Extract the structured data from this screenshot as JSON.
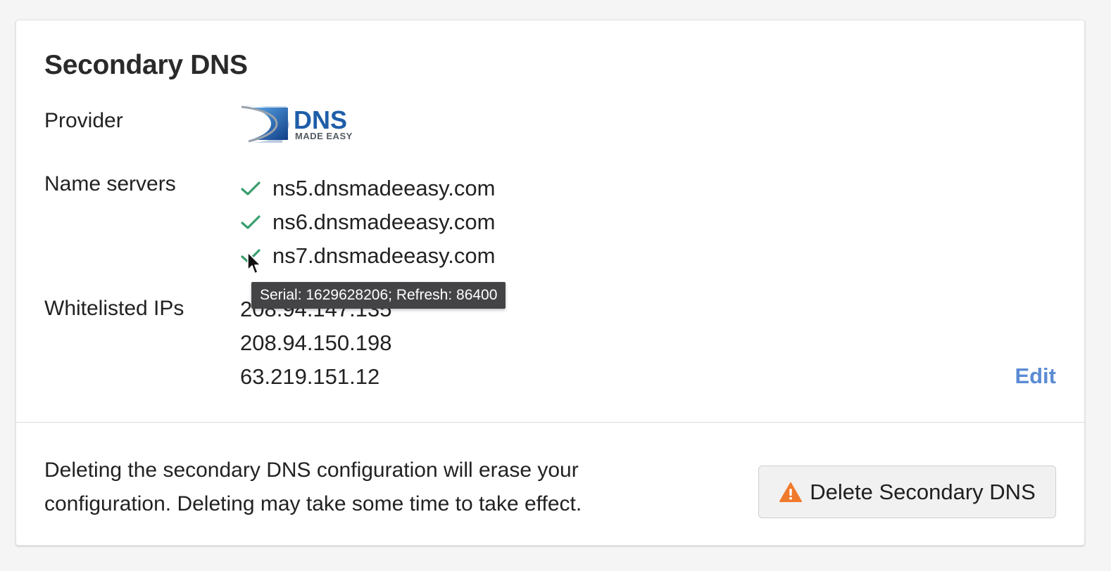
{
  "panel": {
    "title": "Secondary DNS"
  },
  "provider": {
    "label": "Provider",
    "logo_name": "DNS Made Easy logo",
    "logo_text": "DNS",
    "logo_subtext": "MADE EASY"
  },
  "name_servers": {
    "label": "Name servers",
    "items": [
      {
        "host": "ns5.dnsmadeeasy.com",
        "status": "ok"
      },
      {
        "host": "ns6.dnsmadeeasy.com",
        "status": "ok"
      },
      {
        "host": "ns7.dnsmadeeasy.com",
        "status": "ok"
      }
    ]
  },
  "tooltip": {
    "text": "Serial: 1629628206; Refresh: 86400"
  },
  "whitelisted_ips": {
    "label": "Whitelisted IPs",
    "items": [
      "208.94.147.135",
      "208.94.150.198",
      "63.219.151.12"
    ]
  },
  "edit_label": "Edit",
  "delete_section": {
    "warning_text": "Deleting the secondary DNS configuration will erase your configuration. Deleting may take some time to take effect.",
    "button_label": "Delete Secondary DNS"
  },
  "colors": {
    "check": "#3a9e6e",
    "link": "#5b8bd4",
    "warning_icon": "#f07a2c",
    "tooltip_bg": "#444447",
    "logo_blue": "#1e5ea8",
    "logo_gray": "#555a62"
  },
  "icons": {
    "check": "check-icon",
    "warning": "warning-triangle-icon",
    "cursor": "mouse-pointer-icon"
  }
}
